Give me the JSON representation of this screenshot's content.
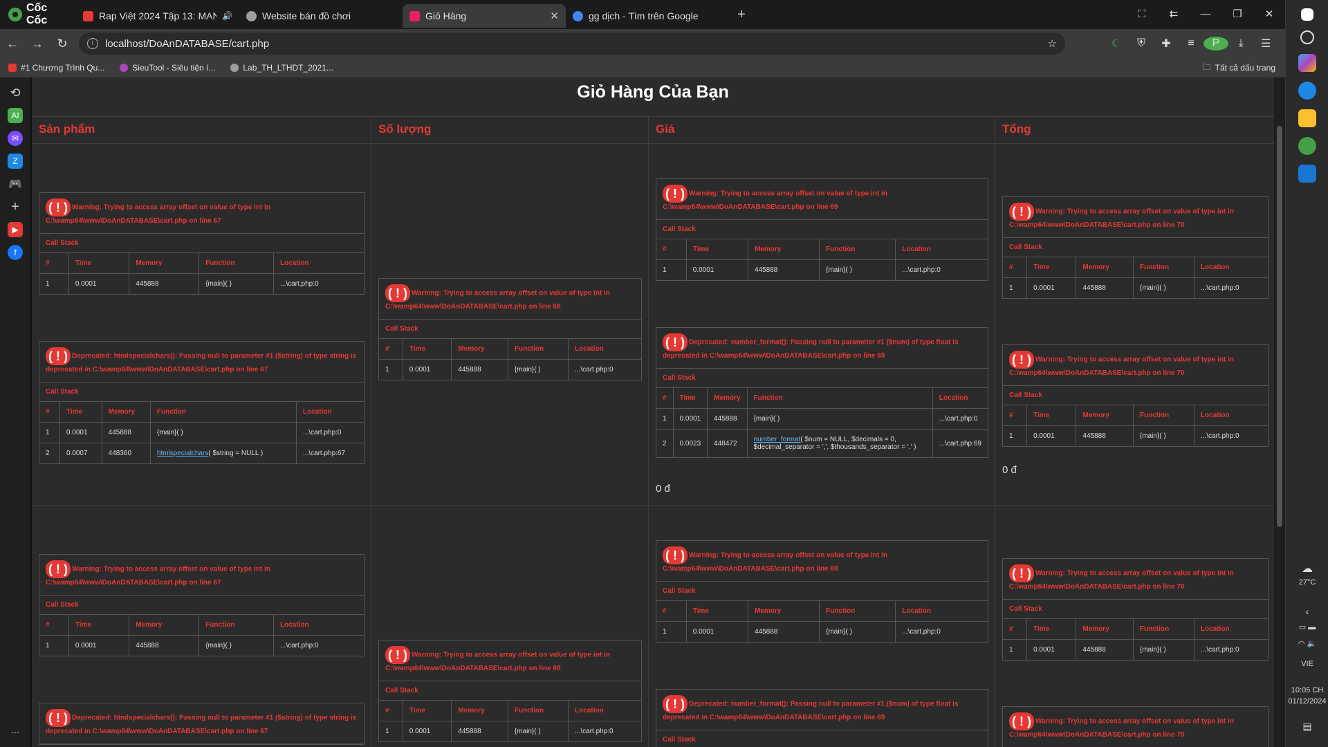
{
  "browser": {
    "brand": "Cốc Cốc",
    "url": "localhost/DoAnDATABASE/cart.php"
  },
  "tabs": [
    {
      "title": "Rap Việt 2024 Tập 13: MANBO",
      "color": "#e53935"
    },
    {
      "title": "Website bán đồ chơi",
      "color": "#9e9e9e"
    },
    {
      "title": "Giỏ Hàng",
      "color": "#e91e63"
    },
    {
      "title": "gg dịch - Tìm trên Google",
      "color": "#4285f4"
    }
  ],
  "bookmarks": [
    {
      "label": "#1 Chương Trình Qu...",
      "color": "#e53935"
    },
    {
      "label": "SieuTool - Siêu tiện í...",
      "color": "#ab47bc"
    },
    {
      "label": "Lab_TH_LTHDT_2021...",
      "color": "#9e9e9e"
    }
  ],
  "bookmarks_all": "Tất cả dấu trang",
  "page": {
    "title": "Giỏ Hàng Của Bạn",
    "headers": [
      "Sản phẩm",
      "Số lượng",
      "Giá",
      "Tổng"
    ],
    "price": "0 đ"
  },
  "err": {
    "w67": "Warning: Trying to access array offset on value of type int in C:\\wamp64\\www\\DoAnDATABASE\\cart.php on line 67",
    "w68": "Warning: Trying to access array offset on value of type int in C:\\wamp64\\www\\DoAnDATABASE\\cart.php on line 68",
    "w69": "Warning: Trying to access array offset on value of type int in C:\\wamp64\\www\\DoAnDATABASE\\cart.php on line 69",
    "w70": "Warning: Trying to access array offset on value of type int in C:\\wamp64\\www\\DoAnDATABASE\\cart.php on line 70",
    "d67": "Deprecated: htmlspecialchars(): Passing null to parameter #1 ($string) of type string is deprecated in C:\\wamp64\\www\\DoAnDATABASE\\cart.php on line 67",
    "d69": "Deprecated: number_format(): Passing null to parameter #1 ($num) of type float is deprecated in C:\\wamp64\\www\\DoAnDATABASE\\cart.php on line 69",
    "bang": "( ! )",
    "callstack": "Call Stack",
    "cols": [
      "#",
      "Time",
      "Memory",
      "Function",
      "Location"
    ],
    "r1": [
      "1",
      "0.0001",
      "445888",
      "{main}( )",
      "...\\cart.php:0"
    ],
    "hs_fn": "htmlspecialchars",
    "hs_args": "( $string = NULL )",
    "hs_row": [
      "2",
      "0.0007",
      "448360",
      "...\\cart.php:67"
    ],
    "nf_fn": "number_format",
    "nf_args": "( $num = NULL, $decimals = 0, $decimal_separator = ',', $thousands_separator = '.' )",
    "nf_row": [
      "2",
      "0.0023",
      "448472",
      "...\\cart.php:69"
    ]
  },
  "taskbar": {
    "weather": "27°C",
    "lang": "VIE",
    "time": "10:05 CH",
    "date": "01/12/2024"
  }
}
